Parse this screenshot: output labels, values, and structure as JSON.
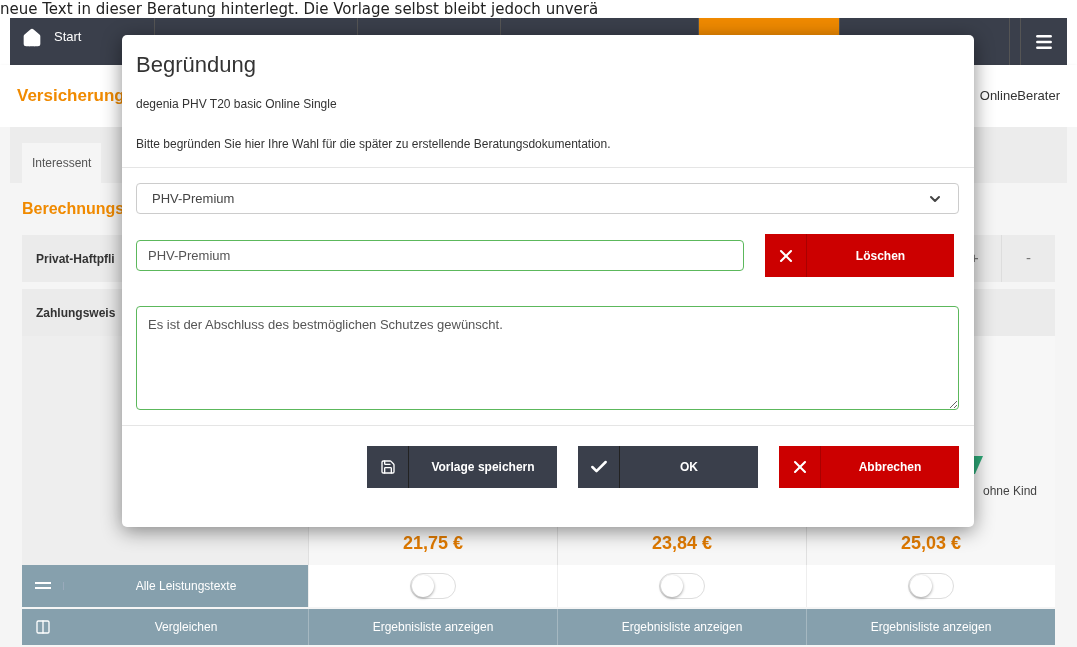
{
  "banner": {
    "text": "neue Text in dieser Beratung hinterlegt. Die Vorlage selbst bleibt jedoch unverä"
  },
  "nav": {
    "tabs": [
      {
        "label": "Start",
        "selected": false
      },
      {
        "selected": false
      },
      {
        "selected": false
      },
      {
        "selected": false
      },
      {
        "selected": true
      },
      {
        "selected": false
      }
    ]
  },
  "header": {
    "title": "Versicherung",
    "user": "OnlineBerater"
  },
  "subtabs": [
    {
      "label": "Interessent",
      "selected": true
    }
  ],
  "section_title": "Berechnungs",
  "rows": [
    {
      "label": "Privat-Haftpfli",
      "plus": "+",
      "minus": "-"
    },
    {
      "label": "Zahlungsweis"
    }
  ],
  "results": {
    "badge_label": "ohne Kind",
    "prices": [
      "21,75 €",
      "23,84 €",
      "25,03 €"
    ],
    "toggles": [
      {
        "on": false
      },
      {
        "on": false
      },
      {
        "on": false
      }
    ],
    "all_texts": "Alle Leistungstexte",
    "compare": "Vergleichen",
    "list_buttons": [
      "Ergebnisliste anzeigen",
      "Ergebnisliste anzeigen",
      "Ergebnisliste anzeigen"
    ]
  },
  "dialog": {
    "title": "Begründung",
    "product": "degenia PHV T20 basic Online Single",
    "instruction": "Bitte begründen Sie hier Ihre Wahl für die später zu erstellende Beratungsdokumentation.",
    "template_select": "PHV-Premium",
    "template_name": "PHV-Premium",
    "delete_button": "Löschen",
    "reason": "Es ist der Abschluss des bestmöglichen Schutzes gewünscht.",
    "buttons": [
      {
        "label": "Vorlage speichern",
        "kind": "save"
      },
      {
        "label": "OK",
        "kind": "ok"
      },
      {
        "label": "Abbrechen",
        "kind": "cancel"
      }
    ]
  }
}
